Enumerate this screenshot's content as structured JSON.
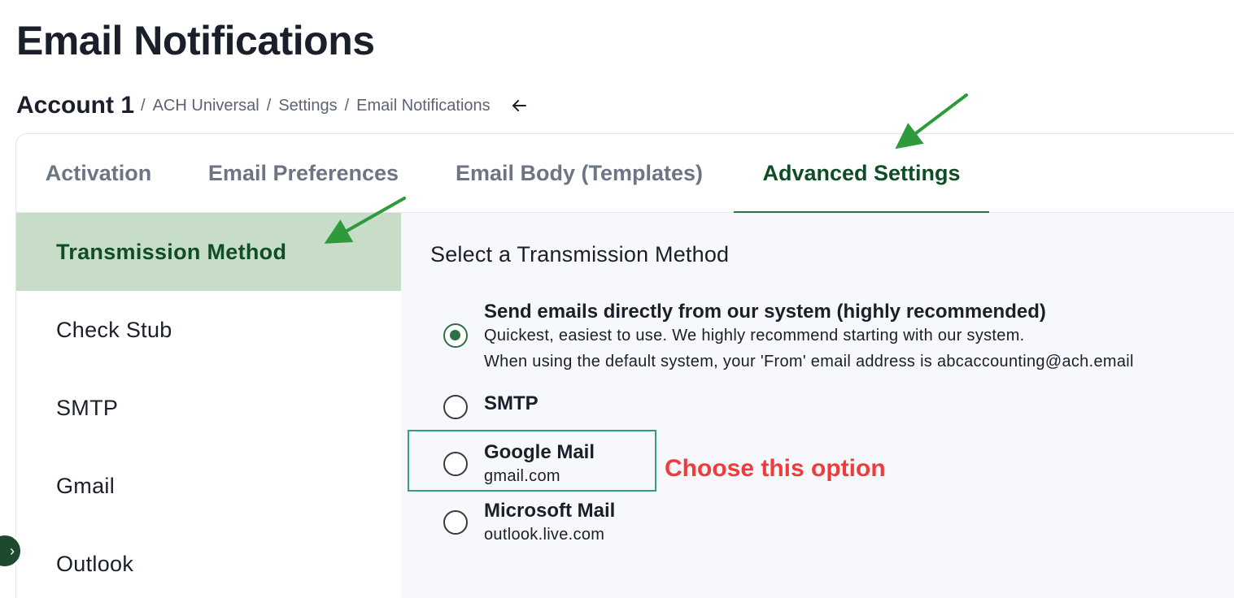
{
  "page": {
    "title": "Email Notifications"
  },
  "breadcrumb": {
    "account": "Account 1",
    "separator": "/",
    "crumbs": [
      "ACH Universal",
      "Settings",
      "Email Notifications"
    ],
    "back_icon": "arrow-left-icon"
  },
  "tabs": [
    {
      "label": "Activation",
      "active": false
    },
    {
      "label": "Email Preferences",
      "active": false
    },
    {
      "label": "Email Body (Templates)",
      "active": false
    },
    {
      "label": "Advanced Settings",
      "active": true
    }
  ],
  "sidebar": {
    "items": [
      {
        "label": "Transmission Method",
        "active": true
      },
      {
        "label": "Check Stub",
        "active": false
      },
      {
        "label": "SMTP",
        "active": false
      },
      {
        "label": "Gmail",
        "active": false
      },
      {
        "label": "Outlook",
        "active": false
      }
    ]
  },
  "main": {
    "section_title": "Select a Transmission Method",
    "options": [
      {
        "title": "Send emails directly from our system (highly recommended)",
        "lines": [
          "Quickest, easiest to use. We highly recommend starting with our system.",
          "When using the default system, your 'From' email address is abcaccounting@ach.email"
        ],
        "checked": true
      },
      {
        "title": "SMTP",
        "lines": [],
        "checked": false
      },
      {
        "title": "Google Mail",
        "lines": [
          "gmail.com"
        ],
        "checked": false
      },
      {
        "title": "Microsoft Mail",
        "lines": [
          "outlook.live.com"
        ],
        "checked": false
      }
    ]
  },
  "annotation": {
    "callout_text": "Choose this option",
    "callout_color": "#ee3b3b",
    "box_color": "#2e9e86",
    "arrow_color": "#2e9a3c"
  },
  "colors": {
    "brand_green": "#2f6f45",
    "active_tab_text": "#0f4d24",
    "sidebar_active_bg": "#c8ddc8"
  }
}
